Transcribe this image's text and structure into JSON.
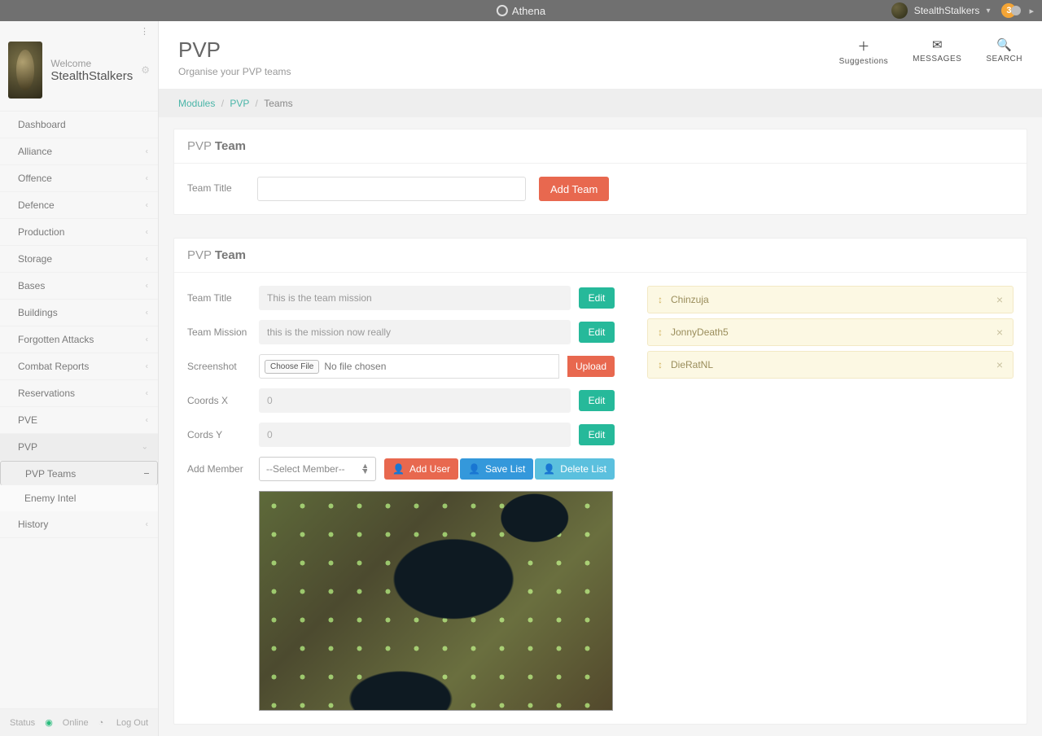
{
  "topbar": {
    "app": "Athena",
    "user": "StealthStalkers",
    "badge": "3"
  },
  "side": {
    "welcome": "Welcome",
    "user": "StealthStalkers",
    "items": [
      {
        "label": "Dashboard"
      },
      {
        "label": "Alliance"
      },
      {
        "label": "Offence"
      },
      {
        "label": "Defence"
      },
      {
        "label": "Production"
      },
      {
        "label": "Storage"
      },
      {
        "label": "Bases"
      },
      {
        "label": "Buildings"
      },
      {
        "label": "Forgotten Attacks"
      },
      {
        "label": "Combat Reports"
      },
      {
        "label": "Reservations"
      },
      {
        "label": "PVE"
      },
      {
        "label": "PVP"
      }
    ],
    "subs": [
      {
        "label": "PVP Teams"
      },
      {
        "label": "Enemy Intel"
      }
    ],
    "last": {
      "label": "History"
    },
    "footer": {
      "status": "Status",
      "online": "Online",
      "logout": "Log Out"
    }
  },
  "header": {
    "title": "PVP",
    "subtitle": "Organise your PVP teams",
    "actions": {
      "suggestions": "Suggestions",
      "messages": "MESSAGES",
      "search": "SEARCH"
    }
  },
  "crumbs": {
    "a": "Modules",
    "b": "PVP",
    "c": "Teams"
  },
  "panel1": {
    "title_a": "PVP ",
    "title_b": "Team",
    "label": "Team Title",
    "btn": "Add Team"
  },
  "panel2": {
    "title_a": "PVP ",
    "title_b": "Team",
    "rows": {
      "teamTitle": {
        "lab": "Team Title",
        "val": "This is the team mission",
        "edit": "Edit"
      },
      "mission": {
        "lab": "Team Mission",
        "val": "this is the mission now really",
        "edit": "Edit"
      },
      "screenshot": {
        "lab": "Screenshot",
        "choose": "Choose File",
        "nofile": "No file chosen",
        "upload": "Upload"
      },
      "cx": {
        "lab": "Coords X",
        "val": "0",
        "edit": "Edit"
      },
      "cy": {
        "lab": "Cords Y",
        "val": "0",
        "edit": "Edit"
      },
      "add": {
        "lab": "Add Member",
        "placeholder": "--Select Member--",
        "addUser": "Add User",
        "saveList": "Save List",
        "deleteList": "Delete List"
      }
    },
    "members": [
      "Chinzuja",
      "JonnyDeath5",
      "DieRatNL"
    ]
  }
}
